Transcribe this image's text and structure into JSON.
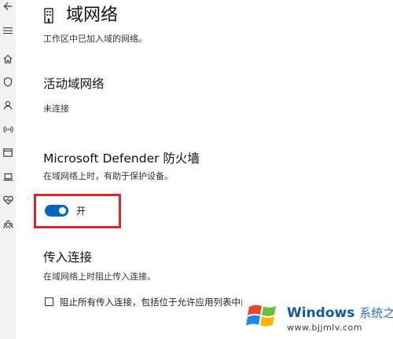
{
  "header": {
    "icon": "building-network-icon",
    "title": "域网络",
    "description": "工作区中已加入域的网络。"
  },
  "rail": {
    "items": [
      "back-icon",
      "menu-icon",
      "home-icon",
      "shield-icon",
      "person-icon",
      "wireless-icon",
      "browser-window-icon",
      "laptop-icon",
      "heart-health-icon",
      "family-icon"
    ]
  },
  "active_networks": {
    "heading": "活动域网络",
    "value": "未连接"
  },
  "firewall": {
    "heading": "Microsoft Defender 防火墙",
    "description": "在域网络上时，有助于保护设备。",
    "toggle_state": true,
    "toggle_label": "开",
    "highlight_color": "#e0242b",
    "accent_color": "#0067c0"
  },
  "incoming": {
    "heading": "传入连接",
    "description": "在域网络上时阻止传入连接。",
    "checkbox_checked": false,
    "checkbox_label": "阻止所有传入连接，包括位于允许应用列表中的"
  },
  "watermark": {
    "title": "Windows",
    "title_zh": "系统之家",
    "url": "www.bjjmlv.com"
  }
}
